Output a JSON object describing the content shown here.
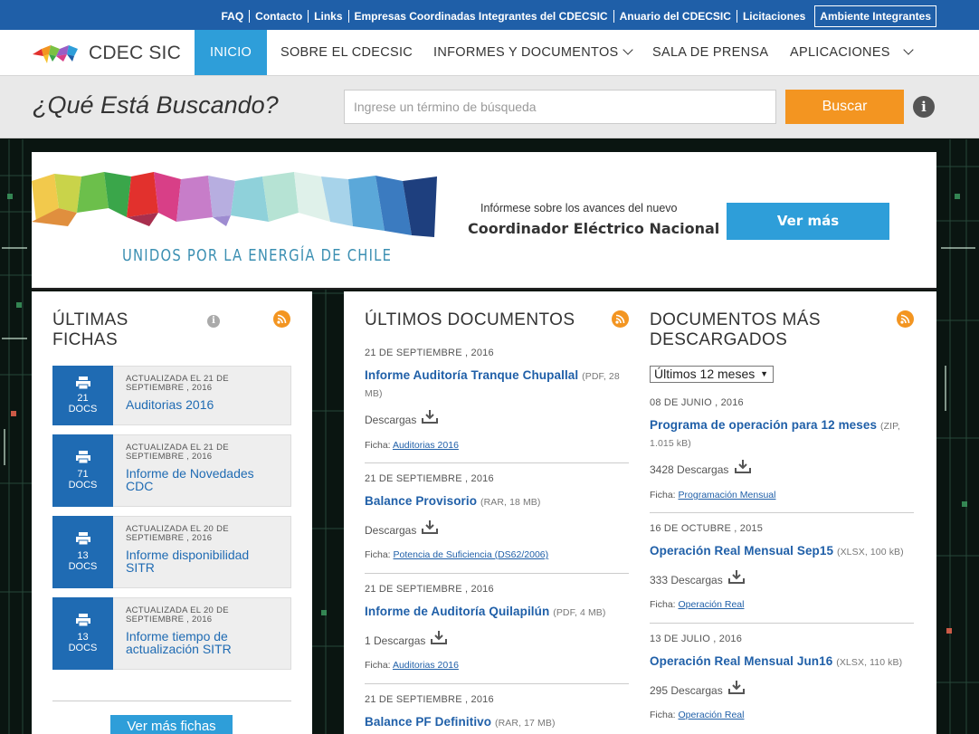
{
  "topbar": {
    "links": [
      "FAQ",
      "Contacto",
      "Links",
      "Empresas Coordinadas Integrantes del CDECSIC",
      "Anuario del CDECSIC",
      "Licitaciones"
    ],
    "boxed_link": "Ambiente Integrantes"
  },
  "nav": {
    "logo": "CDEC SIC",
    "items": [
      "INICIO",
      "SOBRE EL CDECSIC",
      "INFORMES Y DOCUMENTOS",
      "SALA DE PRENSA",
      "APLICACIONES"
    ]
  },
  "search": {
    "title": "¿Qué Está Buscando?",
    "placeholder": "Ingrese un término de búsqueda",
    "button": "Buscar",
    "info": "i"
  },
  "banner": {
    "slogan": "UNIDOS POR LA ENERGÍA DE CHILE",
    "subtitle": "Infórmese sobre los avances del nuevo",
    "title": "Coordinador Eléctrico Nacional",
    "button": "Ver más"
  },
  "ultimas_fichas": {
    "title": "ÚLTIMAS FICHAS",
    "title_line1": "ÚLTIMAS",
    "title_line2": "FICHAS",
    "info": "i",
    "items": [
      {
        "count": "21",
        "docs": "DOCS",
        "updated": "ACTUALIZADA EL 21 DE SEPTIEMBRE , 2016",
        "name": "Auditorias 2016"
      },
      {
        "count": "71",
        "docs": "DOCS",
        "updated": "ACTUALIZADA EL 21 DE SEPTIEMBRE , 2016",
        "name": "Informe de Novedades CDC"
      },
      {
        "count": "13",
        "docs": "DOCS",
        "updated": "ACTUALIZADA EL 20 DE SEPTIEMBRE , 2016",
        "name": "Informe disponibilidad SITR"
      },
      {
        "count": "13",
        "docs": "DOCS",
        "updated": "ACTUALIZADA EL 20 DE SEPTIEMBRE , 2016",
        "name": "Informe tiempo de actualización SITR"
      }
    ],
    "more_button": "Ver más fichas"
  },
  "ultimos_documentos": {
    "title": "ÚLTIMOS DOCUMENTOS",
    "items": [
      {
        "date": "21 DE SEPTIEMBRE , 2016",
        "title": "Informe Auditoría Tranque Chupallal",
        "meta": "(PDF, 28 MB)",
        "downloads": "Descargas",
        "ficha_label": "Ficha:",
        "ficha": "Auditorias 2016"
      },
      {
        "date": "21 DE SEPTIEMBRE , 2016",
        "title": "Balance Provisorio",
        "meta": "(RAR, 18 MB)",
        "downloads": "Descargas",
        "ficha_label": "Ficha:",
        "ficha": "Potencia de Suficiencia (DS62/2006)"
      },
      {
        "date": "21 DE SEPTIEMBRE , 2016",
        "title": "Informe de Auditoría Quilapilún",
        "meta": "(PDF, 4 MB)",
        "downloads": "1 Descargas",
        "ficha_label": "Ficha:",
        "ficha": "Auditorias 2016"
      },
      {
        "date": "21 DE SEPTIEMBRE , 2016",
        "title": "Balance PF Definitivo",
        "meta": "(RAR, 17 MB)"
      }
    ]
  },
  "mas_descargados": {
    "title": "DOCUMENTOS MÁS DESCARGADOS",
    "title_line1": "DOCUMENTOS MÁS",
    "title_line2": "DESCARGADOS",
    "filter": "Últimos 12 meses",
    "items": [
      {
        "date": "08 DE JUNIO , 2016",
        "title": "Programa de operación para 12 meses",
        "meta": "(ZIP, 1.015 kB)",
        "downloads": "3428 Descargas",
        "ficha_label": "Ficha:",
        "ficha": "Programación Mensual"
      },
      {
        "date": "16 DE OCTUBRE , 2015",
        "title": "Operación Real Mensual Sep15",
        "meta": "(XLSX, 100 kB)",
        "downloads": "333 Descargas",
        "ficha_label": "Ficha:",
        "ficha": "Operación Real"
      },
      {
        "date": "13 DE JULIO , 2016",
        "title": "Operación Real Mensual Jun16",
        "meta": "(XLSX, 110 kB)",
        "downloads": "295 Descargas",
        "ficha_label": "Ficha:",
        "ficha": "Operación Real"
      }
    ]
  },
  "colors": {
    "topbar": "#1f5fa8",
    "nav_active": "#2e9ed9",
    "search_button": "#f39521",
    "ficha_box": "#1f6bb3",
    "rss": "#f39521"
  }
}
